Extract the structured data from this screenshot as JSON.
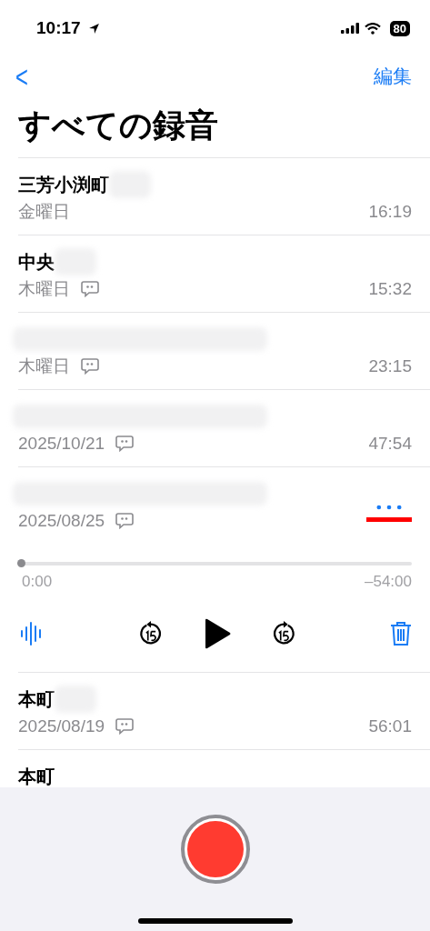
{
  "status_bar": {
    "time": "10:17",
    "battery": "80"
  },
  "nav": {
    "back": "<",
    "edit": "編集"
  },
  "title": "すべての録音",
  "recordings": [
    {
      "title": "三芳小渕町",
      "redacted": true,
      "date": "金曜日",
      "transcript": false,
      "duration": "16:19",
      "expanded": false
    },
    {
      "title": "中央",
      "redacted": true,
      "date": "木曜日",
      "transcript": true,
      "duration": "15:32",
      "expanded": false
    },
    {
      "redacted": true,
      "date": "木曜日",
      "transcript": true,
      "duration": "23:15",
      "expanded": false
    },
    {
      "redacted": true,
      "date": "2025/10/21",
      "transcript": true,
      "duration": "47:54",
      "expanded": false
    },
    {
      "redacted": true,
      "date": "2025/08/25",
      "transcript": true,
      "expanded": true,
      "more_marked": true,
      "player": {
        "level": 0,
        "elapsed": "0:00",
        "remaining": "–54:00"
      }
    },
    {
      "title": "本町",
      "redacted": true,
      "date": "2025/08/19",
      "transcript": true,
      "duration": "56:01",
      "expanded": false
    },
    {
      "title": "本町",
      "redacted": false,
      "expanded": false
    }
  ]
}
